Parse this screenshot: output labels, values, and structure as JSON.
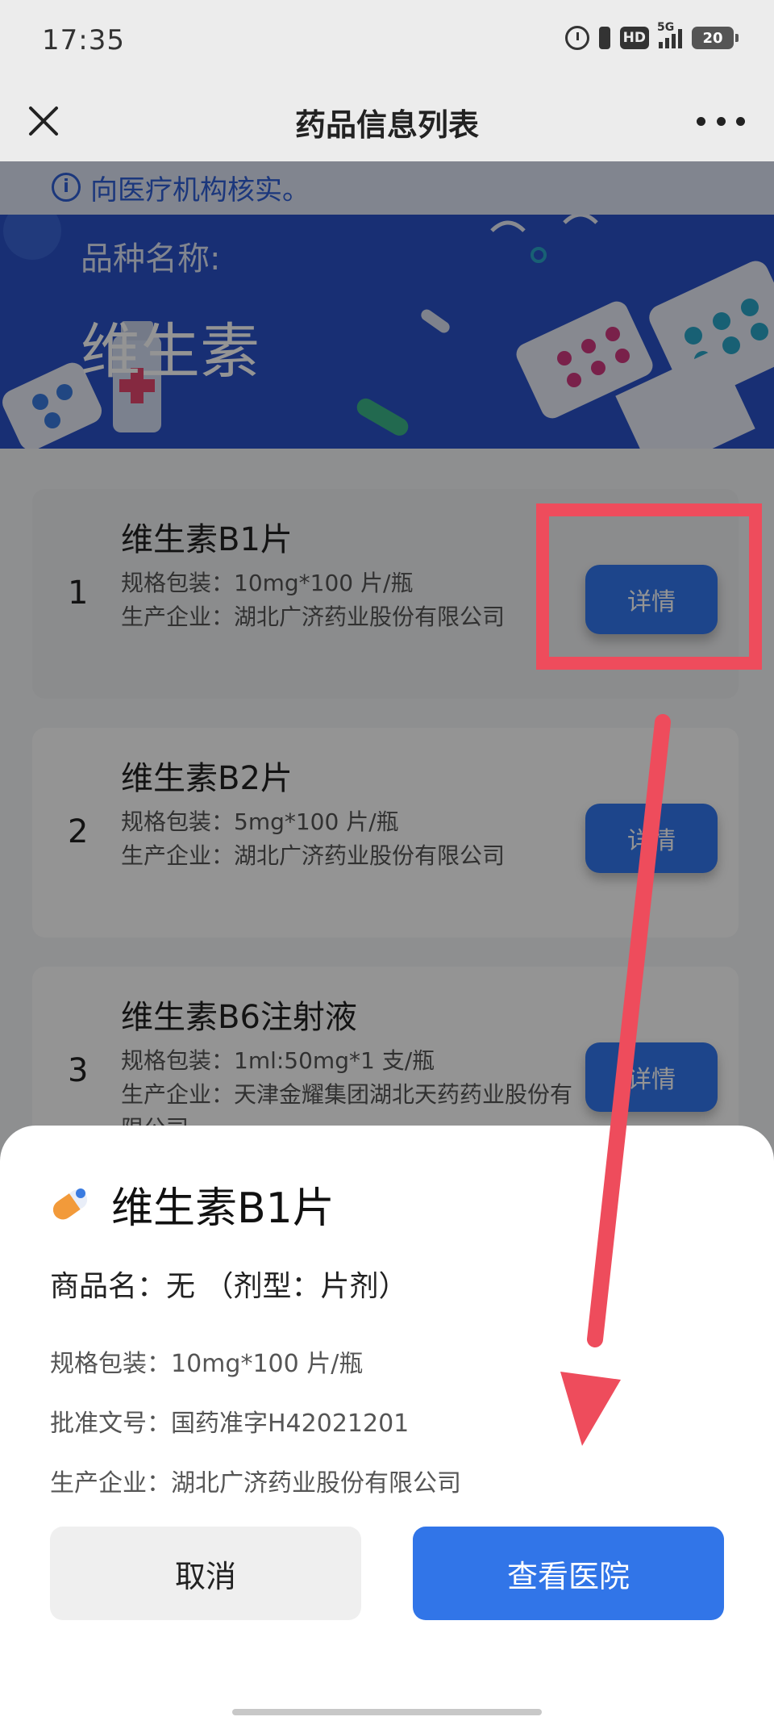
{
  "status_bar": {
    "time": "17:35",
    "icons": [
      "alarm-icon",
      "vibrate-icon",
      "hd-icon",
      "signal-5g-icon",
      "battery-icon"
    ],
    "hd_label": "HD",
    "network_label": "5G",
    "battery_level": "20"
  },
  "nav": {
    "title": "药品信息列表",
    "close_icon": "close-icon",
    "more_icon": "more-dots-icon"
  },
  "notice": {
    "text": "向医疗机构核实。"
  },
  "hero": {
    "label": "品种名称:",
    "name": "维生素"
  },
  "drugs": [
    {
      "index": "1",
      "name": "维生素B1片",
      "spec": "规格包装：10mg*100 片/瓶",
      "maker": "生产企业：湖北广济药业股份有限公司",
      "detail_label": "详情"
    },
    {
      "index": "2",
      "name": "维生素B2片",
      "spec": "规格包装：5mg*100 片/瓶",
      "maker": "生产企业：湖北广济药业股份有限公司",
      "detail_label": "详情"
    },
    {
      "index": "3",
      "name": "维生素B6注射液",
      "spec": "规格包装：1ml:50mg*1 支/瓶",
      "maker": "生产企业：天津金耀集团湖北天药药业股份有限公司",
      "detail_label": "详情"
    }
  ],
  "sheet": {
    "title": "维生素B1片",
    "trade_name": "商品名：无 （剂型：片剂）",
    "spec": "规格包装：10mg*100 片/瓶",
    "approval": "批准文号：国药准字H42021201",
    "maker": "生产企业：湖北广济药业股份有限公司",
    "cancel_label": "取消",
    "view_hospital_label": "查看医院"
  },
  "colors": {
    "primary_blue": "#3175e8",
    "hero_blue": "#2a52c8",
    "annotation_red": "#ee4c5c"
  }
}
